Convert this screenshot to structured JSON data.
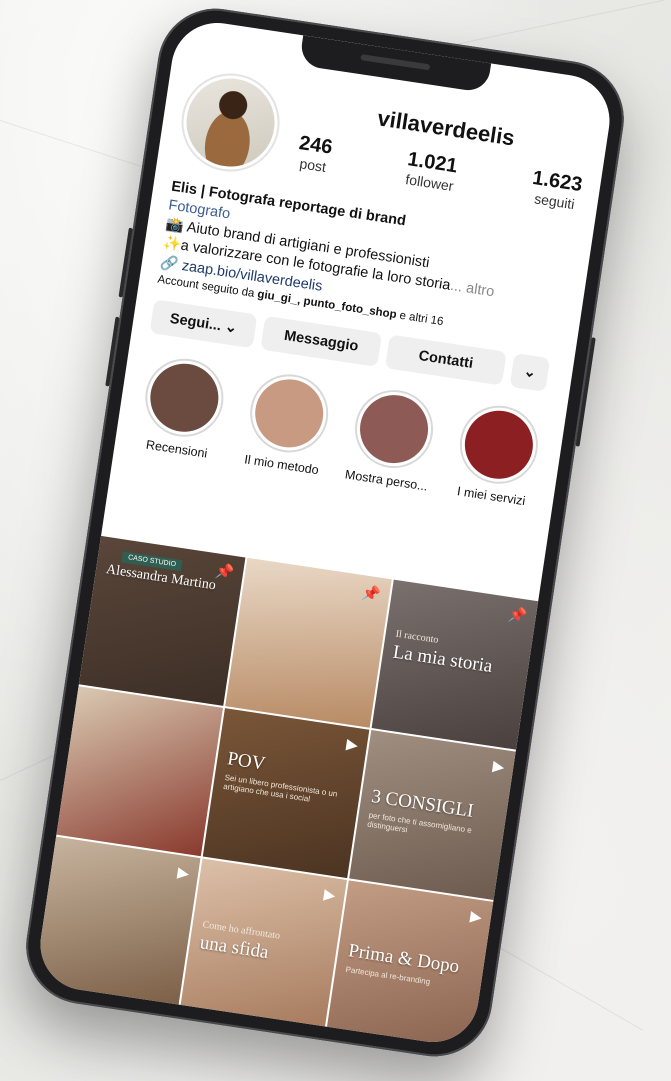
{
  "profile": {
    "username": "villaverdeelis",
    "posts": "246",
    "posts_label": "post",
    "followers": "1.021",
    "followers_label": "follower",
    "following": "1.623",
    "following_label": "seguiti"
  },
  "bio": {
    "name": "Elis | Fotografa reportage di brand",
    "category": "Fotografo",
    "line1": "📸 Aiuto brand di artigiani e professionisti",
    "line2": "✨a valorizzare con le fotografie la loro storia",
    "more": "... altro",
    "link": "zaap.bio/villaverdeelis",
    "followed_prefix": "Account seguito da ",
    "followed_names": "giu_gi_, punto_foto_shop",
    "followed_suffix": " e altri 16"
  },
  "buttons": {
    "follow": "Segui... ⌄",
    "message": "Messaggio",
    "contact": "Contatti",
    "more": "⌄"
  },
  "highlights": [
    {
      "label": "Recensioni",
      "color": "#6b4a3f"
    },
    {
      "label": "Il mio metodo",
      "color": "#c89a82"
    },
    {
      "label": "Mostra perso...",
      "color": "#8e5a55"
    },
    {
      "label": "I miei servizi",
      "color": "#8b1f22"
    }
  ],
  "grid": [
    {
      "title": "Alessandra Martino",
      "kicker": "",
      "sub": "",
      "tag": "CASO STUDIO",
      "badge": "pin",
      "bg": "#4f3d31"
    },
    {
      "title": "",
      "kicker": "",
      "sub": "",
      "tag": "",
      "badge": "pin",
      "bg": "#d9b89c"
    },
    {
      "title": "La mia storia",
      "kicker": "Il racconto",
      "sub": "",
      "tag": "",
      "badge": "pin",
      "bg": "#6e6462"
    },
    {
      "title": "",
      "kicker": "",
      "sub": "",
      "tag": "",
      "badge": "",
      "bg": "#a5906f"
    },
    {
      "title": "POV",
      "kicker": "",
      "sub": "Sei un libero professionista o un artigiano che usa i social",
      "tag": "",
      "badge": "reel",
      "bg": "#6a4a30"
    },
    {
      "title": "3 CONSIGLI",
      "kicker": "",
      "sub": "per foto che ti assomigliano e distinguersi",
      "tag": "",
      "badge": "reel",
      "bg": "#8e7a6d"
    },
    {
      "title": "",
      "kicker": "",
      "sub": "",
      "tag": "",
      "badge": "reel",
      "bg": "#b7a189"
    },
    {
      "title": "una sfida",
      "kicker": "Come ho affrontato",
      "sub": "",
      "tag": "",
      "badge": "reel",
      "bg": "#c9a48a"
    },
    {
      "title": "Prima & Dopo",
      "kicker": "",
      "sub": "Partecipa al re-branding",
      "tag": "",
      "badge": "reel",
      "bg": "#a88470"
    }
  ]
}
